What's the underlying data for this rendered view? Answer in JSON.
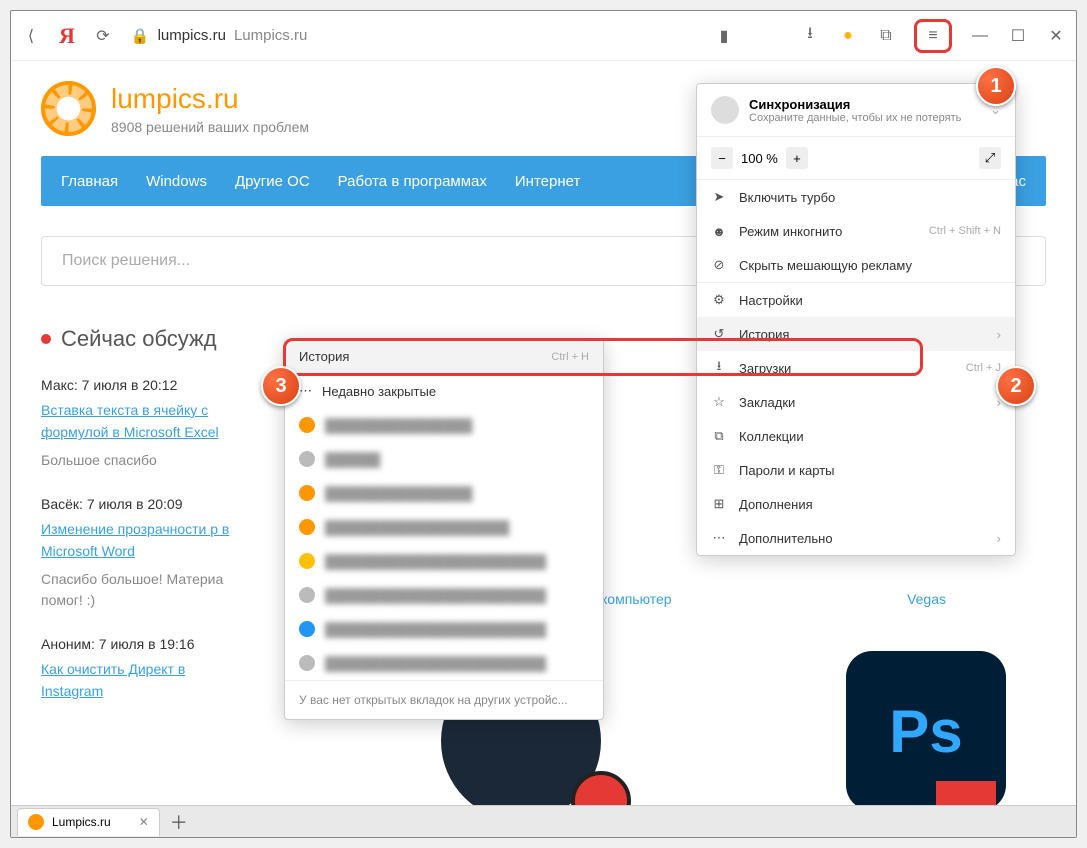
{
  "toolbar": {
    "domain": "lumpics.ru",
    "title": "Lumpics.ru"
  },
  "site": {
    "brand": "lumpics.ru",
    "tagline": "8908 решений ваших проблем"
  },
  "nav": {
    "items": [
      "Главная",
      "Windows",
      "Другие ОС",
      "Работа в программах",
      "Интернет"
    ],
    "about": "О нас"
  },
  "search": {
    "placeholder": "Поиск решения..."
  },
  "discuss": {
    "heading": "Сейчас обсужд",
    "posts": [
      {
        "meta": "Макс: 7 июля в 20:12",
        "link": "Вставка текста в ячейку с формулой в Microsoft Excel",
        "comment": "Большое спасибо"
      },
      {
        "meta": "Васёк: 7 июля в 20:09",
        "link": "Изменение прозрачности р в Microsoft Word",
        "comment": "Спасибо большое! Материа помог! :)"
      },
      {
        "meta": "Аноним: 7 июля в 19:16",
        "link": "Как очистить Директ в Instagram",
        "comment": ""
      }
    ]
  },
  "cards": {
    "label1": "компьютер",
    "label2": "Vegas",
    "ps": "Ps"
  },
  "menu": {
    "sync": {
      "title": "Синхронизация",
      "subtitle": "Сохраните данные, чтобы их не потерять"
    },
    "zoom": {
      "minus": "−",
      "value": "100 %",
      "plus": "+"
    },
    "items_a": [
      {
        "icon": "rocket-icon",
        "label": "Включить турбо"
      },
      {
        "icon": "mask-icon",
        "label": "Режим инкогнито",
        "shortcut": "Ctrl + Shift + N"
      },
      {
        "icon": "block-icon",
        "label": "Скрыть мешающую рекламу"
      }
    ],
    "items_b": [
      {
        "icon": "gear-icon",
        "label": "Настройки"
      }
    ],
    "history": {
      "icon": "history-icon",
      "label": "История"
    },
    "items_c": [
      {
        "icon": "download-icon",
        "label": "Загрузки",
        "shortcut": "Ctrl + J"
      },
      {
        "icon": "star-icon",
        "label": "Закладки",
        "chev": true
      },
      {
        "icon": "collection-icon",
        "label": "Коллекции"
      },
      {
        "icon": "key-icon",
        "label": "Пароли и карты"
      },
      {
        "icon": "puzzle-icon",
        "label": "Дополнения"
      },
      {
        "icon": "more-icon",
        "label": "Дополнительно",
        "chev": true
      }
    ]
  },
  "submenu": {
    "title": "История",
    "shortcut": "Ctrl + H",
    "recent": "Недавно закрытые",
    "note": "У вас нет открытых вкладок на других устройс..."
  },
  "callouts": {
    "c1": "1",
    "c2": "2",
    "c3": "3"
  },
  "tab": {
    "title": "Lumpics.ru"
  }
}
